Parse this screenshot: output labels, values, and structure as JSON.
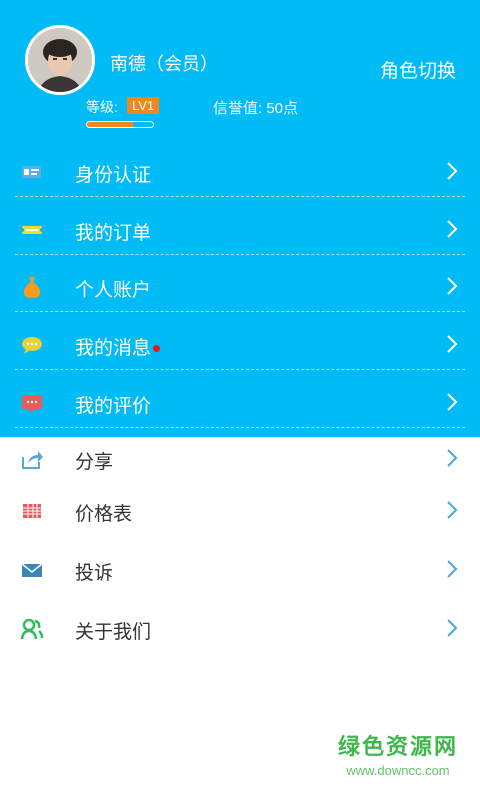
{
  "profile": {
    "name": "南德（会员）",
    "role_switch": "角色切换",
    "level_label": "等级:",
    "level_badge": "LV1",
    "credit": "信誉值: 50点",
    "level_progress": 0.7
  },
  "menu_top": [
    {
      "label": "身份认证",
      "icon": "id-card-icon",
      "icon_color": "#5AB0E3"
    },
    {
      "label": "我的订单",
      "icon": "ticket-icon",
      "icon_color": "#E8DB3B"
    },
    {
      "label": "个人账户",
      "icon": "money-bag-icon",
      "icon_color": "#F59A23"
    },
    {
      "label": "我的消息",
      "icon": "chat-bubble-icon",
      "icon_color": "#E6D23A",
      "has_dot": true
    },
    {
      "label": "我的评价",
      "icon": "comment-icon",
      "icon_color": "#E75C57"
    }
  ],
  "menu_bottom": [
    {
      "label": "分享",
      "icon": "share-icon",
      "icon_color": "#5AA8D8"
    },
    {
      "label": "价格表",
      "icon": "price-table-icon",
      "icon_color": "#E25A5A"
    },
    {
      "label": "投诉",
      "icon": "envelope-icon",
      "icon_color": "#3A86B8"
    },
    {
      "label": "关于我们",
      "icon": "users-icon",
      "icon_color": "#2FBE5A"
    }
  ],
  "watermark": {
    "title": "绿色资源网",
    "url": "www.downcc.com"
  },
  "colors": {
    "header_bg": "#00BBF6",
    "badge": "#F5861F",
    "chevron": "#4AA6E0",
    "notification_dot": "#E21B1B"
  }
}
